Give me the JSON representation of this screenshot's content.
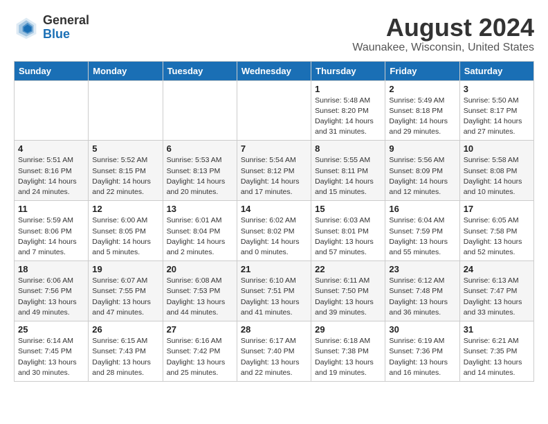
{
  "header": {
    "logo_general": "General",
    "logo_blue": "Blue",
    "month_title": "August 2024",
    "location": "Waunakee, Wisconsin, United States"
  },
  "days_of_week": [
    "Sunday",
    "Monday",
    "Tuesday",
    "Wednesday",
    "Thursday",
    "Friday",
    "Saturday"
  ],
  "weeks": [
    [
      {
        "day": "",
        "detail": ""
      },
      {
        "day": "",
        "detail": ""
      },
      {
        "day": "",
        "detail": ""
      },
      {
        "day": "",
        "detail": ""
      },
      {
        "day": "1",
        "detail": "Sunrise: 5:48 AM\nSunset: 8:20 PM\nDaylight: 14 hours\nand 31 minutes."
      },
      {
        "day": "2",
        "detail": "Sunrise: 5:49 AM\nSunset: 8:18 PM\nDaylight: 14 hours\nand 29 minutes."
      },
      {
        "day": "3",
        "detail": "Sunrise: 5:50 AM\nSunset: 8:17 PM\nDaylight: 14 hours\nand 27 minutes."
      }
    ],
    [
      {
        "day": "4",
        "detail": "Sunrise: 5:51 AM\nSunset: 8:16 PM\nDaylight: 14 hours\nand 24 minutes."
      },
      {
        "day": "5",
        "detail": "Sunrise: 5:52 AM\nSunset: 8:15 PM\nDaylight: 14 hours\nand 22 minutes."
      },
      {
        "day": "6",
        "detail": "Sunrise: 5:53 AM\nSunset: 8:13 PM\nDaylight: 14 hours\nand 20 minutes."
      },
      {
        "day": "7",
        "detail": "Sunrise: 5:54 AM\nSunset: 8:12 PM\nDaylight: 14 hours\nand 17 minutes."
      },
      {
        "day": "8",
        "detail": "Sunrise: 5:55 AM\nSunset: 8:11 PM\nDaylight: 14 hours\nand 15 minutes."
      },
      {
        "day": "9",
        "detail": "Sunrise: 5:56 AM\nSunset: 8:09 PM\nDaylight: 14 hours\nand 12 minutes."
      },
      {
        "day": "10",
        "detail": "Sunrise: 5:58 AM\nSunset: 8:08 PM\nDaylight: 14 hours\nand 10 minutes."
      }
    ],
    [
      {
        "day": "11",
        "detail": "Sunrise: 5:59 AM\nSunset: 8:06 PM\nDaylight: 14 hours\nand 7 minutes."
      },
      {
        "day": "12",
        "detail": "Sunrise: 6:00 AM\nSunset: 8:05 PM\nDaylight: 14 hours\nand 5 minutes."
      },
      {
        "day": "13",
        "detail": "Sunrise: 6:01 AM\nSunset: 8:04 PM\nDaylight: 14 hours\nand 2 minutes."
      },
      {
        "day": "14",
        "detail": "Sunrise: 6:02 AM\nSunset: 8:02 PM\nDaylight: 14 hours\nand 0 minutes."
      },
      {
        "day": "15",
        "detail": "Sunrise: 6:03 AM\nSunset: 8:01 PM\nDaylight: 13 hours\nand 57 minutes."
      },
      {
        "day": "16",
        "detail": "Sunrise: 6:04 AM\nSunset: 7:59 PM\nDaylight: 13 hours\nand 55 minutes."
      },
      {
        "day": "17",
        "detail": "Sunrise: 6:05 AM\nSunset: 7:58 PM\nDaylight: 13 hours\nand 52 minutes."
      }
    ],
    [
      {
        "day": "18",
        "detail": "Sunrise: 6:06 AM\nSunset: 7:56 PM\nDaylight: 13 hours\nand 49 minutes."
      },
      {
        "day": "19",
        "detail": "Sunrise: 6:07 AM\nSunset: 7:55 PM\nDaylight: 13 hours\nand 47 minutes."
      },
      {
        "day": "20",
        "detail": "Sunrise: 6:08 AM\nSunset: 7:53 PM\nDaylight: 13 hours\nand 44 minutes."
      },
      {
        "day": "21",
        "detail": "Sunrise: 6:10 AM\nSunset: 7:51 PM\nDaylight: 13 hours\nand 41 minutes."
      },
      {
        "day": "22",
        "detail": "Sunrise: 6:11 AM\nSunset: 7:50 PM\nDaylight: 13 hours\nand 39 minutes."
      },
      {
        "day": "23",
        "detail": "Sunrise: 6:12 AM\nSunset: 7:48 PM\nDaylight: 13 hours\nand 36 minutes."
      },
      {
        "day": "24",
        "detail": "Sunrise: 6:13 AM\nSunset: 7:47 PM\nDaylight: 13 hours\nand 33 minutes."
      }
    ],
    [
      {
        "day": "25",
        "detail": "Sunrise: 6:14 AM\nSunset: 7:45 PM\nDaylight: 13 hours\nand 30 minutes."
      },
      {
        "day": "26",
        "detail": "Sunrise: 6:15 AM\nSunset: 7:43 PM\nDaylight: 13 hours\nand 28 minutes."
      },
      {
        "day": "27",
        "detail": "Sunrise: 6:16 AM\nSunset: 7:42 PM\nDaylight: 13 hours\nand 25 minutes."
      },
      {
        "day": "28",
        "detail": "Sunrise: 6:17 AM\nSunset: 7:40 PM\nDaylight: 13 hours\nand 22 minutes."
      },
      {
        "day": "29",
        "detail": "Sunrise: 6:18 AM\nSunset: 7:38 PM\nDaylight: 13 hours\nand 19 minutes."
      },
      {
        "day": "30",
        "detail": "Sunrise: 6:19 AM\nSunset: 7:36 PM\nDaylight: 13 hours\nand 16 minutes."
      },
      {
        "day": "31",
        "detail": "Sunrise: 6:21 AM\nSunset: 7:35 PM\nDaylight: 13 hours\nand 14 minutes."
      }
    ]
  ]
}
